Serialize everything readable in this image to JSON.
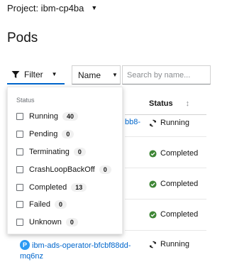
{
  "project": {
    "label": "Project: ibm-cp4ba"
  },
  "page": {
    "title": "Pods"
  },
  "toolbar": {
    "filter_label": "Filter",
    "name_select": "Name",
    "search_placeholder": "Search by name..."
  },
  "table": {
    "status_header": "Status",
    "partial_link": "bb8-",
    "rows": [
      {
        "status": "Running",
        "icon": "sync-icon"
      },
      {
        "status": "Completed",
        "icon": "check-circle-icon"
      },
      {
        "status": "Completed",
        "icon": "check-circle-icon"
      },
      {
        "status": "Completed",
        "icon": "check-circle-icon"
      },
      {
        "status": "Running",
        "icon": "sync-icon"
      }
    ],
    "last_pod": {
      "badge": "P",
      "name": "ibm-ads-operator-bfcbf88dd-mq6nz"
    }
  },
  "filter_menu": {
    "group_title": "Status",
    "items": [
      {
        "label": "Running",
        "count": "40"
      },
      {
        "label": "Pending",
        "count": "0"
      },
      {
        "label": "Terminating",
        "count": "0"
      },
      {
        "label": "CrashLoopBackOff",
        "count": "0"
      },
      {
        "label": "Completed",
        "count": "13"
      },
      {
        "label": "Failed",
        "count": "0"
      },
      {
        "label": "Unknown",
        "count": "0"
      }
    ]
  },
  "colors": {
    "accent": "#0066cc",
    "success": "#3e8635",
    "badge": "#2b9af3"
  }
}
